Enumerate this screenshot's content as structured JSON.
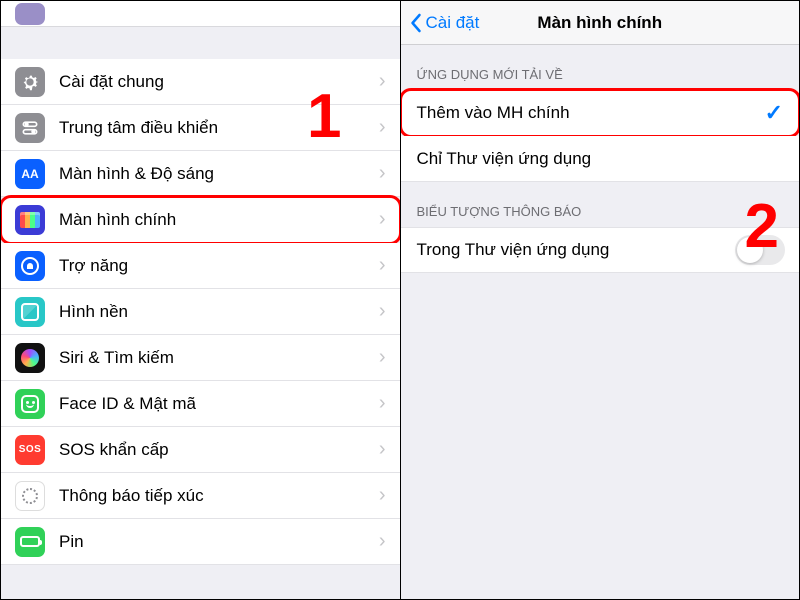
{
  "left": {
    "cut_row_label": "",
    "items": [
      {
        "label": "Cài đặt chung",
        "icon": "general"
      },
      {
        "label": "Trung tâm điều khiển",
        "icon": "control"
      },
      {
        "label": "Màn hình & Độ sáng",
        "icon": "display"
      },
      {
        "label": "Màn hình chính",
        "icon": "home",
        "highlighted": true
      },
      {
        "label": "Trợ năng",
        "icon": "access"
      },
      {
        "label": "Hình nền",
        "icon": "wall"
      },
      {
        "label": "Siri & Tìm kiếm",
        "icon": "siri"
      },
      {
        "label": "Face ID & Mật mã",
        "icon": "face"
      },
      {
        "label": "SOS khẩn cấp",
        "icon": "sos"
      },
      {
        "label": "Thông báo tiếp xúc",
        "icon": "expose"
      },
      {
        "label": "Pin",
        "icon": "battery"
      }
    ],
    "annotation": "1"
  },
  "right": {
    "back_label": "Cài đặt",
    "title": "Màn hình chính",
    "section1_title": "ỨNG DỤNG MỚI TẢI VỀ",
    "section1_items": [
      {
        "label": "Thêm vào MH chính",
        "checked": true,
        "highlighted": true
      },
      {
        "label": "Chỉ Thư viện ứng dụng",
        "checked": false
      }
    ],
    "section2_title": "BIỂU TƯỢNG THÔNG BÁO",
    "section2_items": [
      {
        "label": "Trong Thư viện ứng dụng",
        "toggle": false
      }
    ],
    "annotation": "2"
  }
}
